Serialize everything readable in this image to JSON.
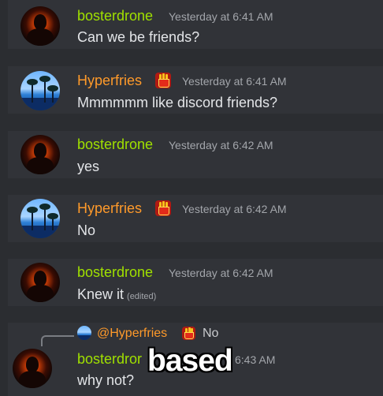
{
  "messages": [
    {
      "author": "bosterdrone",
      "timestamp": "Yesterday at 6:41 AM",
      "content": "Can we be friends?"
    },
    {
      "author": "Hyperfries",
      "badge_icon": "fries-icon",
      "timestamp": "Yesterday at 6:41 AM",
      "content": "Mmmmmm like discord friends?"
    },
    {
      "author": "bosterdrone",
      "timestamp": "Yesterday at 6:42 AM",
      "content": "yes"
    },
    {
      "author": "Hyperfries",
      "badge_icon": "fries-icon",
      "timestamp": "Yesterday at 6:42 AM",
      "content": "No"
    },
    {
      "author": "bosterdrone",
      "timestamp": "Yesterday at 6:42 AM",
      "content": "Knew it",
      "edited": "(edited)"
    },
    {
      "author": "bosterdror",
      "timestamp": "6:43 AM",
      "content": "why not?",
      "reply": {
        "mention": "@Hyperfries",
        "text": "No"
      }
    }
  ],
  "overlay_text": "based",
  "colors": {
    "bosterdrone": "#a0e000",
    "hyperfries": "#ff9a2a",
    "background": "#313338",
    "timestamp": "#a3a6ab",
    "text": "#e3e5e8"
  }
}
